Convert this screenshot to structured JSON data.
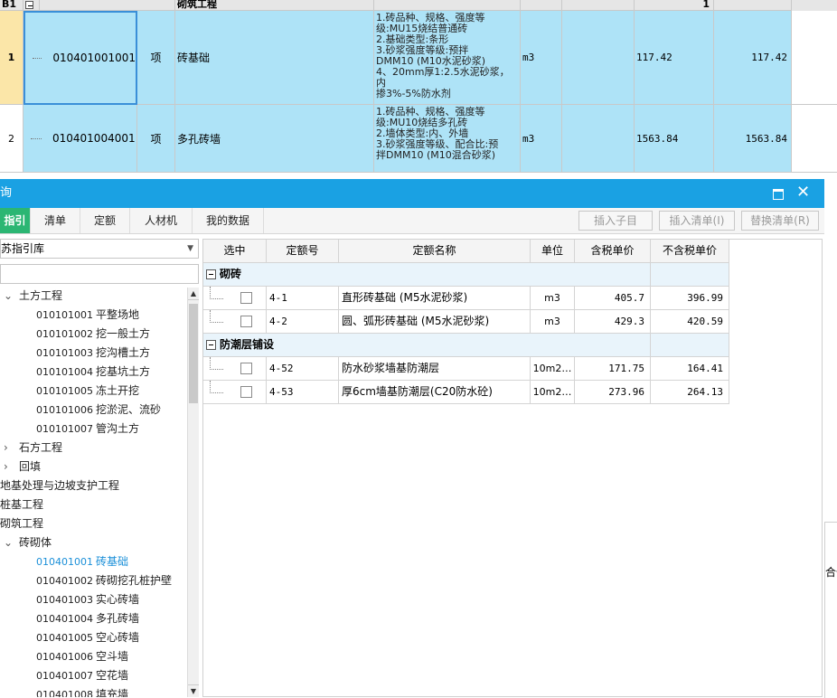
{
  "top_grid": {
    "header": {
      "row_label": "B1",
      "name": "砌筑工程",
      "amount": "1"
    },
    "rows": [
      {
        "num": "1",
        "code": "010401001001",
        "type": "项",
        "name": "砖基础",
        "desc": [
          "1.砖品种、规格、强度等",
          "级:MU15烧结普通砖",
          "2.基础类型:条形",
          "3.砂浆强度等级:预拌",
          "DMM10 (M10水泥砂浆)",
          "4、20mm厚1:2.5水泥砂浆，内",
          "掺3%-5%防水剂"
        ],
        "unit": "m3",
        "qty": "117.42",
        "qty2": "117.42"
      },
      {
        "num": "2",
        "code": "010401004001",
        "type": "项",
        "name": "多孔砖墙",
        "desc": [
          "1.砖品种、规格、强度等",
          "级:MU10烧结多孔砖",
          "2.墙体类型:内、外墙",
          "3.砂浆强度等级、配合比:预",
          "拌DMM10 (M10混合砂浆)"
        ],
        "unit": "m3",
        "qty": "1563.84",
        "qty2": "1563.84"
      }
    ]
  },
  "dialog": {
    "title": "询",
    "maximize_icon": "maximize-icon",
    "close_icon": "close-icon",
    "tabs": [
      "指引",
      "清单",
      "定额",
      "人材机",
      "我的数据"
    ],
    "buttons": {
      "insert_child": "插入子目",
      "insert_list": "插入清单(I)",
      "replace_list": "替换清单(R)"
    },
    "library_select": "苏指引库",
    "search_placeholder": "",
    "tree": [
      {
        "expander": "⌄",
        "code": "",
        "label": "土方工程"
      },
      {
        "expander": "",
        "code": "010101001",
        "label": "平整场地"
      },
      {
        "expander": "",
        "code": "010101002",
        "label": "挖一般土方"
      },
      {
        "expander": "",
        "code": "010101003",
        "label": "挖沟槽土方"
      },
      {
        "expander": "",
        "code": "010101004",
        "label": "挖基坑土方"
      },
      {
        "expander": "",
        "code": "010101005",
        "label": "冻土开挖"
      },
      {
        "expander": "",
        "code": "010101006",
        "label": "挖淤泥、流砂"
      },
      {
        "expander": "",
        "code": "010101007",
        "label": "管沟土方"
      },
      {
        "expander": "›",
        "code": "",
        "label": "石方工程"
      },
      {
        "expander": "›",
        "code": "",
        "label": "回填"
      },
      {
        "expander": "",
        "code": "",
        "label": "地基处理与边坡支护工程"
      },
      {
        "expander": "",
        "code": "",
        "label": "桩基工程"
      },
      {
        "expander": "",
        "code": "",
        "label": "砌筑工程"
      },
      {
        "expander": "⌄",
        "code": "",
        "label": "砖砌体"
      },
      {
        "expander": "",
        "code": "010401001",
        "label": "砖基础",
        "selected": true
      },
      {
        "expander": "",
        "code": "010401002",
        "label": "砖砌挖孔桩护壁"
      },
      {
        "expander": "",
        "code": "010401003",
        "label": "实心砖墙"
      },
      {
        "expander": "",
        "code": "010401004",
        "label": "多孔砖墙"
      },
      {
        "expander": "",
        "code": "010401005",
        "label": "空心砖墙"
      },
      {
        "expander": "",
        "code": "010401006",
        "label": "空斗墙"
      },
      {
        "expander": "",
        "code": "010401007",
        "label": "空花墙"
      },
      {
        "expander": "",
        "code": "010401008",
        "label": "填充墙"
      }
    ],
    "quota_table": {
      "columns": [
        "选中",
        "定额号",
        "定额名称",
        "单位",
        "含税单价",
        "不含税单价"
      ],
      "groups": [
        {
          "name": "砌砖",
          "rows": [
            {
              "code": "4-1",
              "name": "直形砖基础 (M5水泥砂浆)",
              "unit": "m3",
              "price_tax": "405.7",
              "price_notax": "396.99"
            },
            {
              "code": "4-2",
              "name": "圆、弧形砖基础 (M5水泥砂浆)",
              "unit": "m3",
              "price_tax": "429.3",
              "price_notax": "420.59"
            }
          ]
        },
        {
          "name": "防潮层铺设",
          "rows": [
            {
              "code": "4-52",
              "name": "防水砂浆墙基防潮层",
              "unit": "10m2…",
              "price_tax": "171.75",
              "price_notax": "164.41"
            },
            {
              "code": "4-53",
              "name": "厚6cm墙基防潮层(C20防水砼)",
              "unit": "10m2…",
              "price_tax": "273.96",
              "price_notax": "264.13"
            }
          ]
        }
      ]
    }
  },
  "background_right": {
    "text": "合价"
  },
  "colors": {
    "title_bar": "#1aa1e3",
    "active_tab": "#2bb673",
    "row_highlight": "#aee3f7",
    "selected_tree": "#1a8fd8"
  }
}
